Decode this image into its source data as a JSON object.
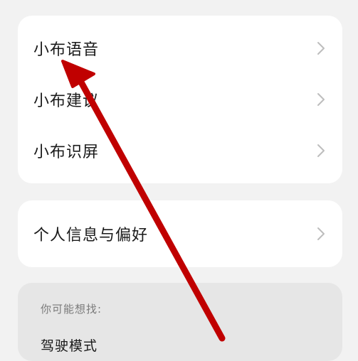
{
  "primary_group": {
    "items": [
      {
        "label": "小布语音",
        "icon": "chevron-right-icon"
      },
      {
        "label": "小布建议",
        "icon": "chevron-right-icon"
      },
      {
        "label": "小布识屏",
        "icon": "chevron-right-icon"
      }
    ]
  },
  "secondary_group": {
    "items": [
      {
        "label": "个人信息与偏好",
        "icon": "chevron-right-icon"
      }
    ]
  },
  "suggestions": {
    "title": "你可能想找:",
    "items": [
      {
        "label": "驾驶模式"
      }
    ]
  },
  "annotation": {
    "arrow_color": "#c00000"
  },
  "colors": {
    "background": "#f2f2f2",
    "card": "#ffffff",
    "suggestion_card": "#e6e6e6",
    "chevron": "#bdbdbd"
  }
}
